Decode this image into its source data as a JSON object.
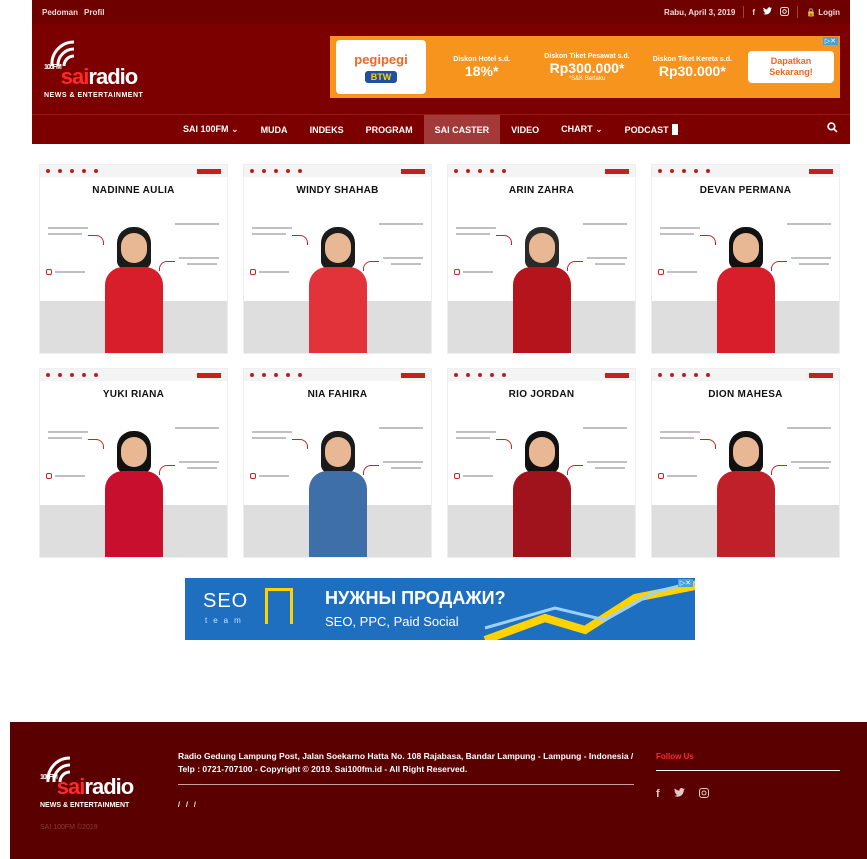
{
  "topbar": {
    "links": [
      "Pedoman",
      "Profil"
    ],
    "date": "Rabu, April 3, 2019",
    "social": [
      "f",
      "t",
      "ig"
    ],
    "login": "Login"
  },
  "header": {
    "logo_100fm": "100FM",
    "logo_sai": "sai",
    "logo_radio": "radio",
    "logo_tagline": "NEWS & ENTERTAINMENT"
  },
  "ad_top": {
    "brand": "pegipegi",
    "badge": "BTW",
    "offers": [
      {
        "title": "Diskon Hotel s.d.",
        "value": "18%*",
        "note": ""
      },
      {
        "title": "Diskon Tiket Pesawat s.d.",
        "value": "Rp300.000*",
        "note": "*S&K Berlaku"
      },
      {
        "title": "Diskon Tiket Kereta s.d.",
        "value": "Rp30.000*",
        "note": ""
      }
    ],
    "cta": "Dapatkan Sekarang!"
  },
  "nav": {
    "items": [
      "SAI 100FM ⌄",
      "MUDA",
      "INDEKS",
      "PROGRAM",
      "SAI CASTER",
      "VIDEO",
      "CHART ⌄",
      "PODCAST"
    ],
    "active_index": 4
  },
  "casters": [
    {
      "name": "NADINNE AULIA",
      "outfit": "#d71e2a",
      "hair": "#1b1b1b"
    },
    {
      "name": "WINDY SHAHAB",
      "outfit": "#e2333a",
      "hair": "#1b1b1b"
    },
    {
      "name": "ARIN ZAHRA",
      "outfit": "#b5141d",
      "hair": "#2a2a2a"
    },
    {
      "name": "DEVAN PERMANA",
      "outfit": "#d71e2a",
      "hair": "#111111"
    },
    {
      "name": "YUKI RIANA",
      "outfit": "#c8102e",
      "hair": "#111111"
    },
    {
      "name": "NIA FAHIRA",
      "outfit": "#3e6fa8",
      "hair": "#1b1b1b"
    },
    {
      "name": "RIO JORDAN",
      "outfit": "#a0121c",
      "hair": "#111111"
    },
    {
      "name": "DION MAHESA",
      "outfit": "#c0202a",
      "hair": "#111111"
    }
  ],
  "ad_seo": {
    "logo": "SEO",
    "team": "team",
    "headline": "НУЖНЫ ПРОДАЖИ?",
    "sub": "SEO, PPC, Paid Social"
  },
  "footer": {
    "address": "Radio Gedung Lampung Post, Jalan Soekarno Hatta No. 108 Rajabasa, Bandar Lampung - Lampung - Indonesia / Telp : 0721-707100 - Copyright © 2019. Sai100fm.id - All Right Reserved.",
    "follow": "Follow Us",
    "copy": "SAI 100FM ©2019"
  },
  "colors": {
    "brand_dark": "#7d0000",
    "brand_red": "#ff2a2a",
    "ad_orange": "#f7941d",
    "ad_blue": "#1f6fc0"
  }
}
